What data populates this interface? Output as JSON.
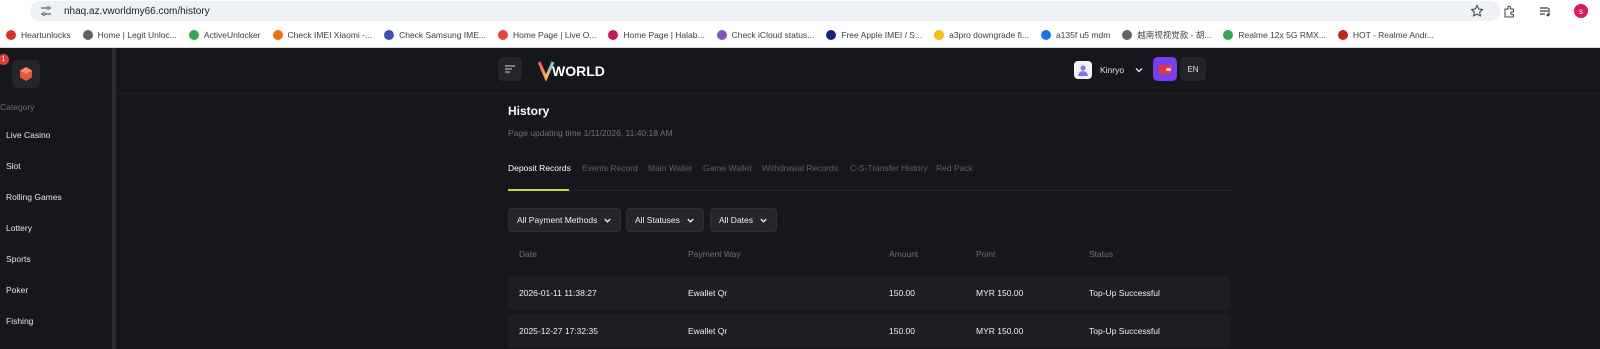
{
  "browser": {
    "url": "nhaq.az.vworldmy66.com/history",
    "profile_initial": "s",
    "bookmarks": [
      {
        "label": "Heartunlocks",
        "color": "#d93025"
      },
      {
        "label": "Home | Legit Unloc...",
        "color": "#5f6368"
      },
      {
        "label": "ActiveUnlocker",
        "color": "#34a853"
      },
      {
        "label": "Check IMEI Xiaomi -...",
        "color": "#e8710a"
      },
      {
        "label": "Check Samsung IME...",
        "color": "#3f51b5"
      },
      {
        "label": "Home Page | Live O...",
        "color": "#ea4335"
      },
      {
        "label": "Home Page | Halab...",
        "color": "#c2185b"
      },
      {
        "label": "Check iCloud status...",
        "color": "#7e57c2"
      },
      {
        "label": "Free Apple IMEI / S...",
        "color": "#1a237e"
      },
      {
        "label": "a3pro downgrade fi...",
        "color": "#fbbc04"
      },
      {
        "label": "a135f u5 mdm",
        "color": "#1a73e8"
      },
      {
        "label": "越南视视觉款 - 胡...",
        "color": "#5f6368"
      },
      {
        "label": "Realme 12x 5G RMX...",
        "color": "#34a853"
      },
      {
        "label": "HOT - Realme Andr...",
        "color": "#c5221f"
      }
    ]
  },
  "sidebar": {
    "badge_count": "1",
    "category_label": "Category",
    "items": [
      "Live Casino",
      "Slot",
      "Rolling Games",
      "Lottery",
      "Sports",
      "Poker",
      "Fishing"
    ]
  },
  "header": {
    "logo_text": "WORLD",
    "username": "Kinryo",
    "language": "EN"
  },
  "page": {
    "title": "History",
    "updating_time": "Page updating time 1/11/2026, 11:40:18 AM"
  },
  "tabs": [
    "Deposit Records",
    "Events Record",
    "Main Wallet",
    "Game Wallet",
    "Withdrawal Records",
    "C-S-Transfer History",
    "Red Pack"
  ],
  "active_tab": "Deposit Records",
  "filters": [
    "All Payment Methods",
    "All Statuses",
    "All Dates"
  ],
  "table": {
    "columns": [
      "Date",
      "Payment Way",
      "Amount",
      "Point",
      "Status"
    ],
    "rows": [
      [
        "2026-01-11 11:38:27",
        "Ewallet Qr",
        "150.00",
        "MYR 150.00",
        "Top-Up Successful"
      ],
      [
        "2025-12-27 17:32:35",
        "Ewallet Qr",
        "150.00",
        "MYR 150.00",
        "Top-Up Successful"
      ]
    ]
  },
  "colors": {
    "background": "#16171b",
    "accent_underline": "#c8d62e",
    "wallet_button": "#7b3df0",
    "row_background": "#1d1e23"
  }
}
